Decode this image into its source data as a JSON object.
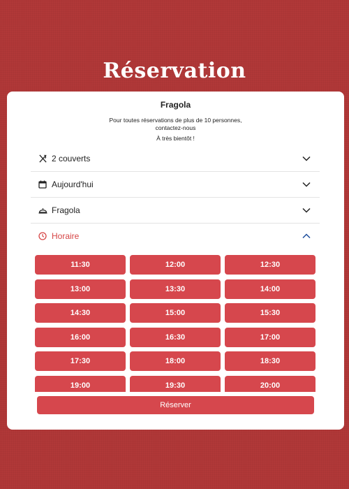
{
  "header": {
    "title": "Réservation"
  },
  "card": {
    "restaurant_name": "Fragola",
    "info_line1": "Pour toutes réservations de plus de 10 personnes,",
    "info_line2": "contactez-nous",
    "closing": "À très bientôt !"
  },
  "selectors": {
    "guests": {
      "label": "2 couverts",
      "icon": "utensils-icon"
    },
    "date": {
      "label": "Aujourd'hui",
      "icon": "calendar-icon"
    },
    "restaurant": {
      "label": "Fragola",
      "icon": "cloche-icon"
    },
    "time": {
      "label": "Horaire",
      "icon": "clock-icon",
      "expanded": true
    }
  },
  "time_slots": [
    "11:30",
    "12:00",
    "12:30",
    "13:00",
    "13:30",
    "14:00",
    "14:30",
    "15:00",
    "15:30",
    "16:00",
    "16:30",
    "17:00",
    "17:30",
    "18:00",
    "18:30",
    "19:00",
    "19:30",
    "20:00"
  ],
  "reserve_button": {
    "label": "Réserver"
  },
  "colors": {
    "background": "#b13838",
    "accent": "#d6474d",
    "active_text": "#d64545",
    "chevron_active": "#1f4e9c"
  }
}
